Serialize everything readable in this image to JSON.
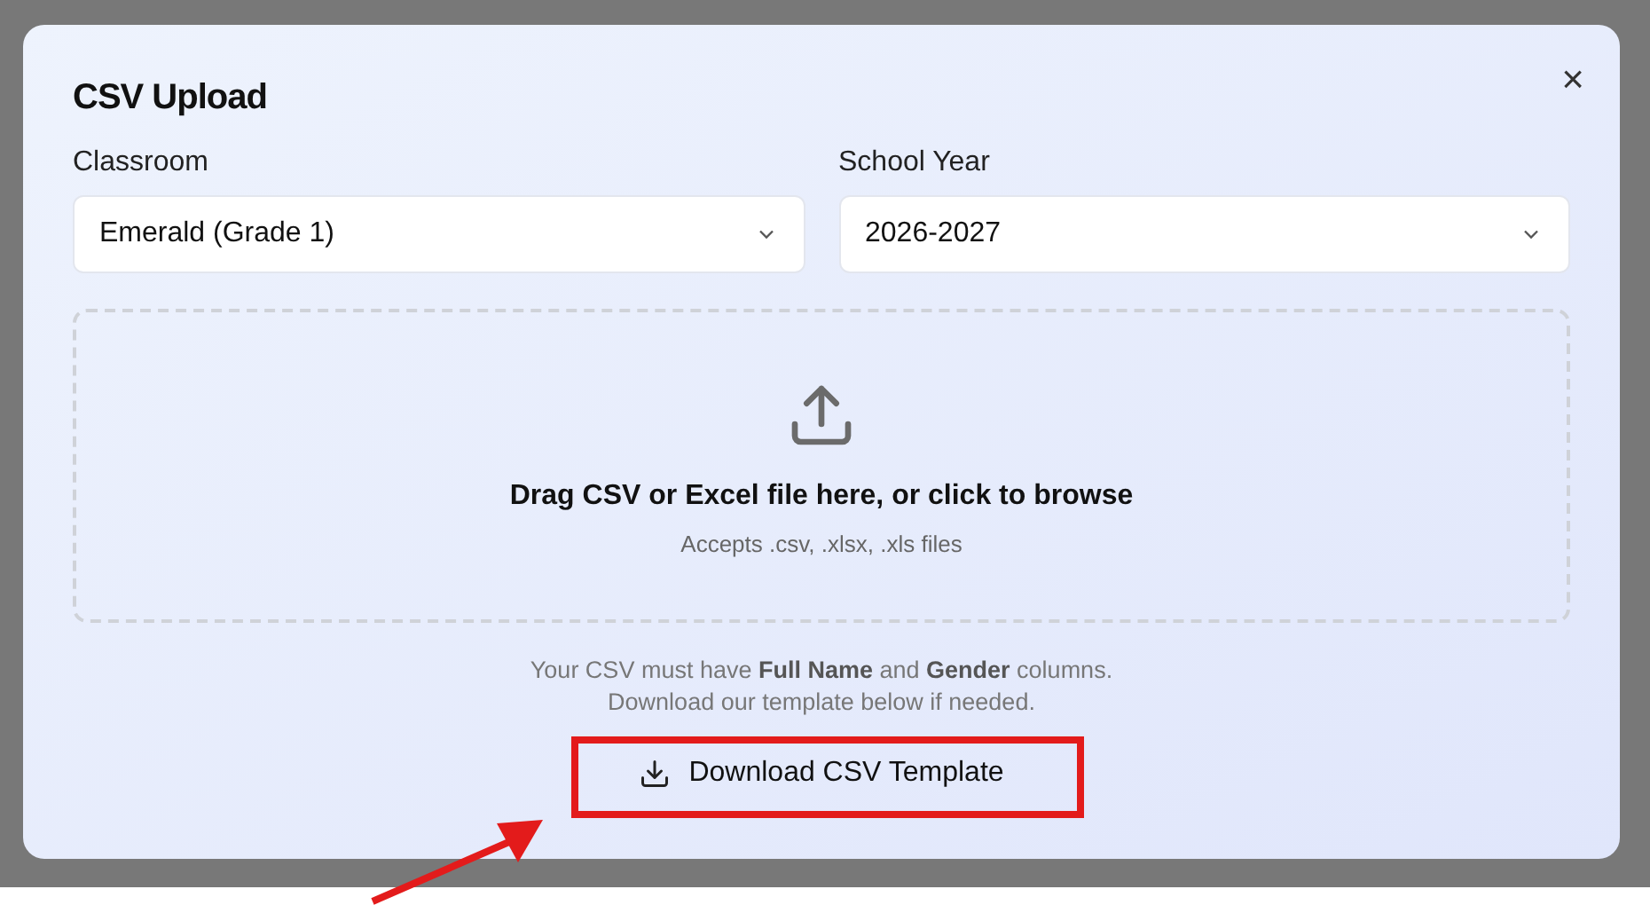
{
  "dialog": {
    "title": "CSV Upload",
    "close": "×"
  },
  "fields": [
    {
      "label": "Classroom",
      "value": "Emerald (Grade 1)"
    },
    {
      "label": "School Year",
      "value": "2026-2027"
    }
  ],
  "dropzone": {
    "text": "Drag CSV or Excel file here, or click to browse",
    "subtext": "Accepts .csv, .xlsx, .xls files"
  },
  "hint": [
    "Your CSV must have **Full Name** and **Gender** columns.",
    "Download our template below if needed."
  ],
  "button": {
    "label": "Download CSV Template"
  },
  "callout": {
    "highlighted": true
  }
}
